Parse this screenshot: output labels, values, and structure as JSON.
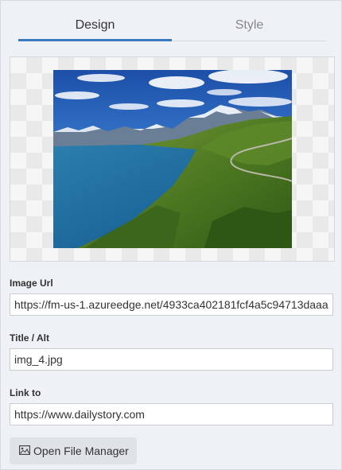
{
  "tabs": {
    "design": "Design",
    "style": "Style"
  },
  "preview": {
    "image_desc": "mountain-lake-landscape"
  },
  "fields": {
    "image_url": {
      "label": "Image Url",
      "value": "https://fm-us-1.azureedge.net/4933ca402181fcf4a5c94713daaa"
    },
    "title_alt": {
      "label": "Title / Alt",
      "value": "img_4.jpg"
    },
    "link_to": {
      "label": "Link to",
      "value": "https://www.dailystory.com"
    }
  },
  "buttons": {
    "open_file_manager": "Open File Manager",
    "open_file_manager_icon": "image-icon"
  },
  "colors": {
    "accent": "#3b78bf",
    "panel_bg": "#eef1f5",
    "button_bg": "#dfe2e6"
  }
}
